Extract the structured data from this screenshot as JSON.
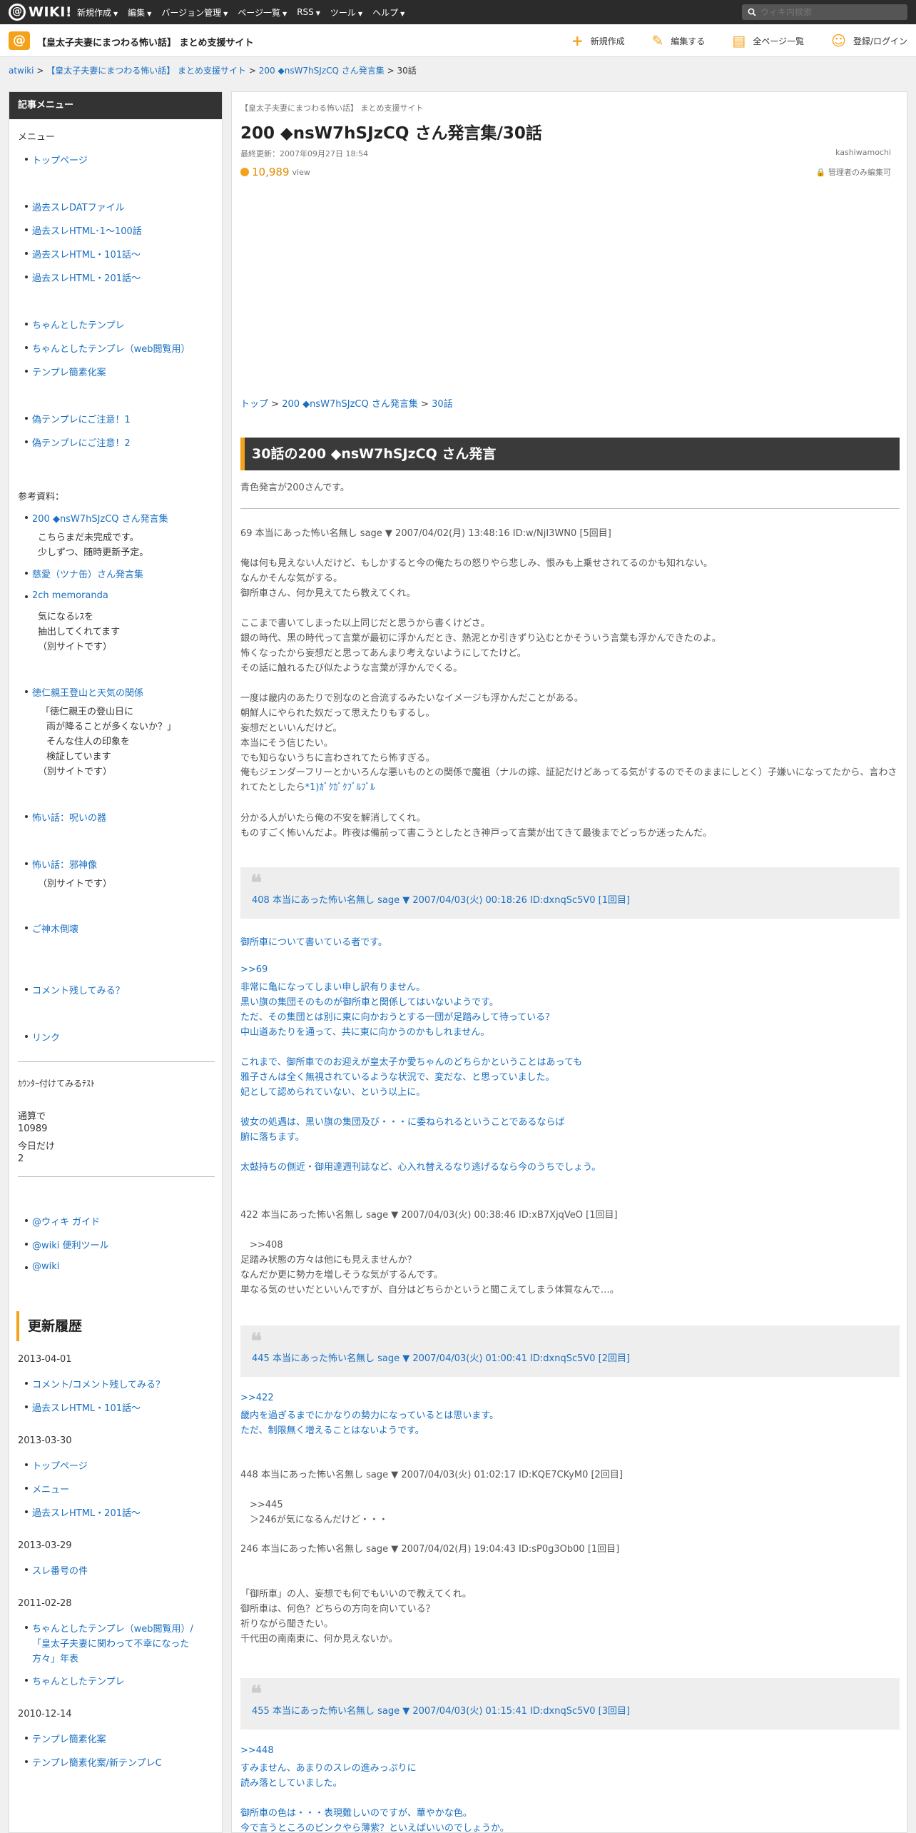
{
  "topbar": {
    "logo_text": "WIKI!",
    "logo_mark": "@",
    "nav": [
      "新規作成",
      "編集",
      "バージョン管理",
      "ページ一覧",
      "RSS",
      "ツール",
      "ヘルプ"
    ],
    "search_placeholder": "ウィキ内検索"
  },
  "header": {
    "site_icon": "@",
    "site_title": "【皇太子夫妻にまつわる怖い話】 まとめ支援サイト",
    "actions": [
      {
        "icon": "plus-icon",
        "label": "新規作成"
      },
      {
        "icon": "pencil-icon",
        "label": "編集する"
      },
      {
        "icon": "page-icon",
        "label": "全ページ一覧"
      },
      {
        "icon": "user-add-icon",
        "label": "登録/ログイン"
      }
    ]
  },
  "breadcrumb": {
    "items": [
      "atwiki",
      "【皇太子夫妻にまつわる怖い話】 まとめ支援サイト",
      "200 ◆nsW7hSJzCQ さん発言集"
    ],
    "current": "30話",
    "sep": ">"
  },
  "sidebar": {
    "title": "記事メニュー",
    "menu_label": "メニュー",
    "top_link": "トップページ",
    "group1": [
      "過去スレDATファイル",
      "過去スレHTML･1～100話",
      "過去スレHTML・101話～",
      "過去スレHTML・201話～"
    ],
    "group2": [
      "ちゃんとしたテンプレ",
      "ちゃんとしたテンプレ（web閲覧用）",
      "テンプレ簡素化案"
    ],
    "group3": [
      "偽テンプレにご注意！1",
      "偽テンプレにご注意！2"
    ],
    "ref_label": "参考資料：",
    "ref_links": [
      "200 ◆nsW7hSJzCQ さん発言集",
      "慈愛（ツナ缶）さん発言集",
      "2ch memoranda",
      "徳仁親王登山と天気の関係",
      "怖い話：呪いの器",
      "怖い話：邪神像",
      "ご神木倒壊",
      "コメント残してみる？",
      "リンク"
    ],
    "notes_200": [
      "こちらまだ未完成です。",
      "少しずつ、随時更新予定。"
    ],
    "notes_2ch": [
      "気になるﾚｽを",
      "抽出してくれてます",
      "（別サイトです）"
    ],
    "notes_tokuhito": [
      "「徳仁親王の登山日に",
      "雨が降ることが多くないか？」",
      "そんな住人の印象を",
      "検証しています",
      "（別サイトです）"
    ],
    "notes_jashin": [
      "（別サイトです）"
    ],
    "counter_label": "ｶｳﾝﾀｰ付けてみるﾃｽﾄ",
    "counter_total_label": "通算で",
    "counter_total": "10989",
    "counter_today_label": "今日だけ",
    "counter_today": "2",
    "bottom_links": [
      "@ウィキ ガイド",
      "@wiki 便利ツール",
      "@wiki"
    ],
    "update_title": "更新履歴",
    "updates": [
      {
        "date": "2013-04-01",
        "items": [
          "コメント/コメント残してみる？",
          "過去スレHTML・101話～"
        ]
      },
      {
        "date": "2013-03-30",
        "items": [
          "トップページ",
          "メニュー",
          "過去スレHTML・201話～"
        ]
      },
      {
        "date": "2013-03-29",
        "items": [
          "スレ番号の件"
        ]
      },
      {
        "date": "2011-02-28",
        "items": [
          "ちゃんとしたテンプレ（web閲覧用）/",
          "「皇太子夫妻に関わって不幸になった",
          "方々」年表",
          "ちゃんとしたテンプレ"
        ]
      },
      {
        "date": "2010-12-14",
        "items": [
          "テンプレ簡素化案",
          "テンプレ簡素化案/新テンプレC"
        ]
      }
    ]
  },
  "main": {
    "site_label": "【皇太子夫妻にまつわる怖い話】 まとめ支援サイト",
    "title": "200 ◆nsW7hSJzCQ さん発言集/30話",
    "updated": "最終更新：2007年09月27日 18:54",
    "author": "kashiwamochi",
    "views": "10,989",
    "views_label": "view",
    "permission": "管理者のみ編集可",
    "page_crumb": [
      "トップ",
      "200 ◆nsW7hSJzCQ さん発言集",
      "30話"
    ],
    "section_title": "30話の200 ◆nsW7hSJzCQ さん発言",
    "intro": "青色発言が200さんです。",
    "posts": {
      "p69_head": "69 本当にあった怖い名無し sage ▼ 2007/04/02(月) 13:48:16 ID:w/NjI3WN0 [5回目]",
      "p69_lines": [
        "俺は何も見えない人だけど、もしかすると今の俺たちの怒りやら悲しみ、恨みも上乗せされてるのかも知れない。",
        "なんかそんな気がする。",
        "御所車さん、何か見えてたら教えてくれ。",
        "",
        "ここまで書いてしまった以上同じだと思うから書くけどさ。",
        "銀の時代、黒の時代って言葉が最初に浮かんだとき、熱泥とか引きずり込むとかそういう言葉も浮かんできたのよ。",
        "怖くなったから妄想だと思ってあんまり考えないようにしてたけど。",
        "その話に触れるたび似たような言葉が浮かんでくる。",
        "",
        "一度は畿内のあたりで別なのと合流するみたいなイメージも浮かんだことがある。",
        "朝鮮人にやられた奴だって思えたりもするし。",
        "妄想だといいんだけど。",
        "本当にそう信じたい。",
        "でも知らないうちに言わされてたら怖すぎる。",
        "俺もジェンダーフリーとかいろんな悪いものとの関係で魔祖（ナルの嫁、証記だけどあってる気がするのでそのままにしとく）子嫌いになってたから、言わされてたとしたら",
        "",
        "分かる人がいたら俺の不安を解消してくれ。",
        "ものすごく怖いんだよ。昨夜は備前って書こうとしたとき神戸って言葉が出てきて最後までどっちか迷ったんだ。"
      ],
      "p69_footnote": "*1)ｶﾞｸｶﾞｸﾌﾞﾙﾌﾞﾙ",
      "q408": "408 本当にあった怖い名無し sage ▼ 2007/04/03(火) 00:18:26 ID:dxnqSc5V0 [1回目]",
      "r408_lines": [
        "御所車について書いている者です。",
        "",
        ">>69",
        "非常に亀になってしまい申し訳有りません。",
        "黒い旗の集団そのものが御所車と関係してはいないようです。",
        "ただ、その集団とは別に東に向かおうとする一団が足踏みして待っている？",
        "中山道あたりを通って、共に東に向かうのかもしれません。",
        "",
        "これまで、御所車でのお迎えが皇太子か愛ちゃんのどちらかということはあっても",
        "雅子さんは全く無視されているような状況で、変だな、と思っていました。",
        "妃として認められていない、という以上に。",
        "",
        "彼女の処遇は、黒い旗の集団及び・・・に委ねられるということであるならば",
        "腑に落ちます。",
        "",
        "太鼓持ちの側近・御用達週刊誌など、心入れ替えるなり逃げるなら今のうちでしょう。"
      ],
      "p422_head": "422 本当にあった怖い名無し sage ▼ 2007/04/03(火) 00:38:46 ID:xB7XjqVeO [1回目]",
      "p422_lines": [
        "　>>408",
        "足踏み状態の方々は他にも見えませんか？",
        "なんだか更に勢力を増しそうな気がするんです。",
        "単なる気のせいだといいんですが、自分はどちらかというと聞こえてしまう体質なんで…。"
      ],
      "q445": "445 本当にあった怖い名無し sage ▼ 2007/04/03(火) 01:00:41 ID:dxnqSc5V0 [2回目]",
      "r445_lines": [
        ">>422",
        "畿内を過ぎるまでにかなりの勢力になっているとは思います。",
        "ただ、制限無く増えることはないようです。"
      ],
      "p448_head": "448 本当にあった怖い名無し sage ▼ 2007/04/03(火) 01:02:17 ID:KQE7CKyM0 [2回目]",
      "p448_lines": [
        "　>>445",
        "　＞246が気になるんだけど・・・"
      ],
      "p246_head": "246 本当にあった怖い名無し sage ▼ 2007/04/02(月) 19:04:43 ID:sP0g3Ob00 [1回目]",
      "p246_lines": [
        "「御所車」の人、妄想でも何でもいいので教えてくれ。",
        "御所車は、何色？どちらの方向を向いている？",
        "祈りながら聞きたい。",
        "千代田の南南東に、何か見えないか。"
      ],
      "q455": "455 本当にあった怖い名無し sage ▼ 2007/04/03(火) 01:15:41 ID:dxnqSc5V0 [3回目]",
      "r455_lines": [
        ">>448",
        "すみません、あまりのスレの進みっぷりに",
        "読み落としていました。",
        "",
        "御所車の色は・・・表現難しいのですが、華やかな色。",
        "今で言うところのピンクやら薄紫？といえばいいのでしょうか。"
      ]
    }
  },
  "colors": {
    "accent": "#f5a21b",
    "link": "#1a6fc1",
    "topbar": "#2b2b2b"
  }
}
